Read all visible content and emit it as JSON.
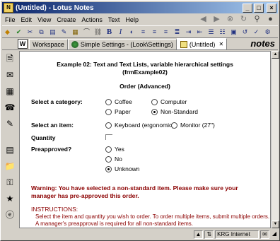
{
  "window": {
    "title": "(Untitled) - Lotus Notes",
    "app_icon": "notes-icon"
  },
  "menu": [
    "File",
    "Edit",
    "View",
    "Create",
    "Actions",
    "Text",
    "Help"
  ],
  "nav_icons": [
    "back-icon",
    "forward-icon",
    "stop-icon",
    "refresh-icon",
    "search-icon",
    "go-icon"
  ],
  "toolbar": {
    "bold": "B",
    "italic": "I"
  },
  "tabs": [
    {
      "label": "Workspace",
      "icon": "workspace-icon"
    },
    {
      "label": "Simple Settings - (Look\\Settings)",
      "icon": "database-icon"
    },
    {
      "label": "(Untitled)",
      "icon": "document-icon",
      "active": true
    }
  ],
  "brand": "notes",
  "form": {
    "title_line1": "Example 02: Text and Text Lists, variable hierarchical settings",
    "title_line2": "(frmExample02)",
    "subtitle": "Order (Advanced)",
    "category_label": "Select a category:",
    "category_options": [
      "Coffee",
      "Computer",
      "Paper",
      "Non-Standard"
    ],
    "category_selected": "Non-Standard",
    "item_label": "Select an item:",
    "item_options": [
      "Keyboard (ergonomic)",
      "Monitor (27\")"
    ],
    "quantity_label": "Quantity",
    "preapproved_label": "Preapproved?",
    "preapproved_options": [
      "Yes",
      "No",
      "Unknown"
    ],
    "preapproved_selected": "Unknown",
    "warning": "Warning: You have selected a non-standard item. Please make sure your manager has pre-approved this order.",
    "instructions_title": "INSTRUCTIONS:",
    "instructions_line1": "Select the item and quantity you wish to order. To order multiple items, submit multiple orders.",
    "instructions_line2": "A manager's preapproval is required for all non-standard items."
  },
  "status": {
    "location": "KRG Internet"
  }
}
